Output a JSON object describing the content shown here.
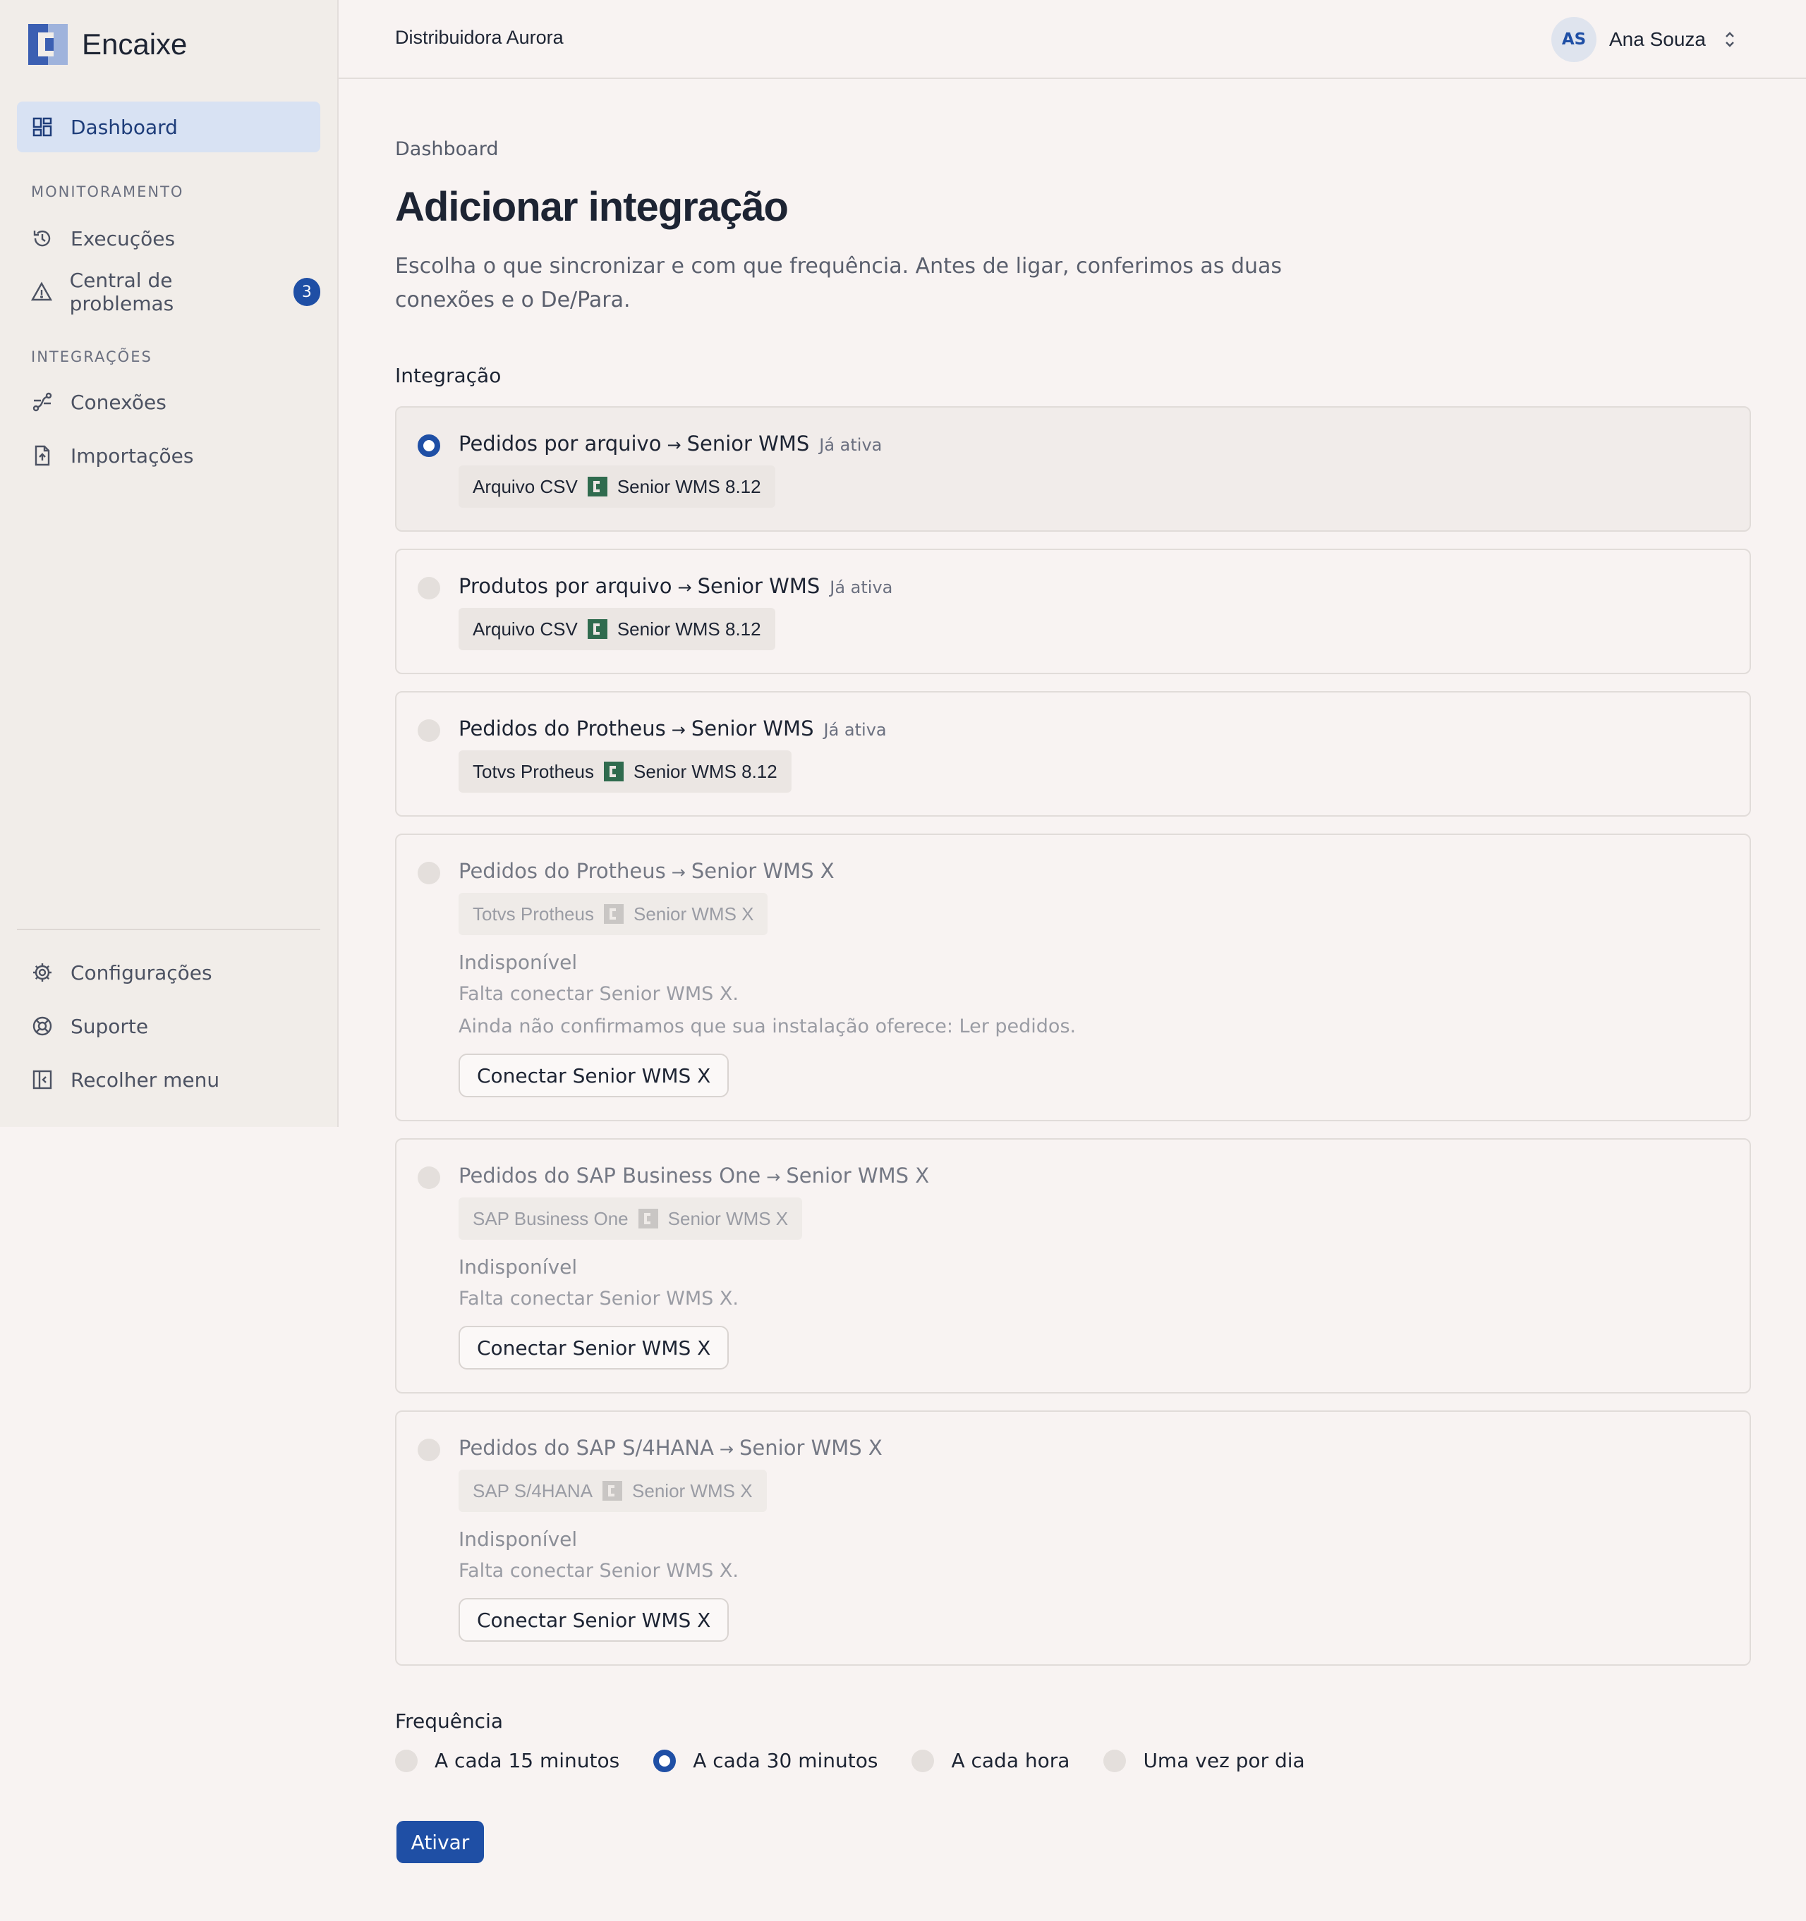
{
  "brand": {
    "name": "Encaixe"
  },
  "header": {
    "org": "Distribuidora Aurora",
    "user_initials": "AS",
    "user_name": "Ana Souza"
  },
  "sidebar": {
    "dashboard": "Dashboard",
    "section_monitoring": "MONITORAMENTO",
    "executions": "Execuções",
    "problems": "Central de problemas",
    "problems_count": "3",
    "section_integrations": "INTEGRAÇÕES",
    "connections": "Conexões",
    "imports": "Importações",
    "settings": "Configurações",
    "support": "Suporte",
    "collapse": "Recolher menu"
  },
  "page": {
    "breadcrumb": "Dashboard",
    "title": "Adicionar integração",
    "description": "Escolha o que sincronizar e com que frequência. Antes de ligar, conferimos as duas conexões e o De/Para.",
    "integration_label": "Integração",
    "frequency_label": "Frequência",
    "activate": "Ativar"
  },
  "integrations": [
    {
      "source_name": "Pedidos por arquivo",
      "arrow": "→",
      "target_name": "Senior WMS",
      "tag": "Já ativa",
      "chip_source": "Arquivo CSV",
      "chip_target": "Senior WMS 8.12",
      "selected": true
    },
    {
      "source_name": "Produtos por arquivo",
      "arrow": "→",
      "target_name": "Senior WMS",
      "tag": "Já ativa",
      "chip_source": "Arquivo CSV",
      "chip_target": "Senior WMS 8.12"
    },
    {
      "source_name": "Pedidos do Protheus",
      "arrow": "→",
      "target_name": "Senior WMS",
      "tag": "Já ativa",
      "chip_source": "Totvs Protheus",
      "chip_target": "Senior WMS 8.12"
    },
    {
      "source_name": "Pedidos do Protheus",
      "arrow": "→",
      "target_name": "Senior WMS X",
      "chip_source": "Totvs Protheus",
      "chip_target": "Senior WMS X",
      "status": "Indisponível",
      "reason1": "Falta conectar Senior WMS X.",
      "reason2": "Ainda não confirmamos que sua instalação oferece: Ler pedidos.",
      "button": "Conectar Senior WMS X"
    },
    {
      "source_name": "Pedidos do SAP Business One",
      "arrow": "→",
      "target_name": "Senior WMS X",
      "chip_source": "SAP Business One",
      "chip_target": "Senior WMS X",
      "status": "Indisponível",
      "reason1": "Falta conectar Senior WMS X.",
      "button": "Conectar Senior WMS X"
    },
    {
      "source_name": "Pedidos do SAP S/4HANA",
      "arrow": "→",
      "target_name": "Senior WMS X",
      "chip_source": "SAP S/4HANA",
      "chip_target": "Senior WMS X",
      "status": "Indisponível",
      "reason1": "Falta conectar Senior WMS X.",
      "button": "Conectar Senior WMS X"
    }
  ],
  "frequency": {
    "options": [
      "A cada 15 minutos",
      "A cada 30 minutos",
      "A cada hora",
      "Uma vez por dia"
    ],
    "selected": "A cada 30 minutos"
  },
  "colors": {
    "accent": "#1f4fa5",
    "chip_icon": "#2f6b4e",
    "background": "#f8f3f2"
  }
}
